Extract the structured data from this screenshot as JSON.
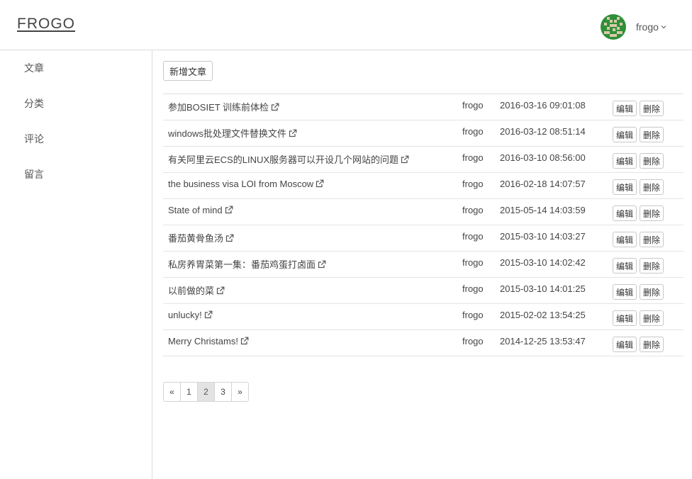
{
  "brand": "FROGO",
  "user": {
    "name": "frogo",
    "avatar_icon": "pixel-avatar-icon",
    "avatar_colors": {
      "primary": "#2f8f3a",
      "secondary": "#d9c9a8"
    }
  },
  "sidebar": {
    "items": [
      {
        "label": "文章"
      },
      {
        "label": "分类"
      },
      {
        "label": "评论"
      },
      {
        "label": "留言"
      }
    ]
  },
  "toolbar": {
    "new_article_label": "新增文章"
  },
  "articles": [
    {
      "title": "参加BOSIET 训练前体检",
      "author": "frogo",
      "date": "2016-03-16 09:01:08",
      "edit_label": "编辑",
      "delete_label": "删除"
    },
    {
      "title": "windows批处理文件替换文件",
      "author": "frogo",
      "date": "2016-03-12 08:51:14",
      "edit_label": "编辑",
      "delete_label": "删除"
    },
    {
      "title": "有关阿里云ECS的LINUX服务器可以开设几个网站的问题",
      "author": "frogo",
      "date": "2016-03-10 08:56:00",
      "edit_label": "编辑",
      "delete_label": "删除"
    },
    {
      "title": "the business visa LOI from Moscow",
      "author": "frogo",
      "date": "2016-02-18 14:07:57",
      "edit_label": "编辑",
      "delete_label": "删除"
    },
    {
      "title": "State of mind",
      "author": "frogo",
      "date": "2015-05-14 14:03:59",
      "edit_label": "编辑",
      "delete_label": "删除"
    },
    {
      "title": "番茄黄骨鱼汤",
      "author": "frogo",
      "date": "2015-03-10 14:03:27",
      "edit_label": "编辑",
      "delete_label": "删除"
    },
    {
      "title": "私房养胃菜第一集：番茄鸡蛋打卤面",
      "author": "frogo",
      "date": "2015-03-10 14:02:42",
      "edit_label": "编辑",
      "delete_label": "删除"
    },
    {
      "title": "以前做的菜",
      "author": "frogo",
      "date": "2015-03-10 14:01:25",
      "edit_label": "编辑",
      "delete_label": "删除"
    },
    {
      "title": "unlucky!",
      "author": "frogo",
      "date": "2015-02-02 13:54:25",
      "edit_label": "编辑",
      "delete_label": "删除"
    },
    {
      "title": "Merry Christams!",
      "author": "frogo",
      "date": "2014-12-25 13:53:47",
      "edit_label": "编辑",
      "delete_label": "删除"
    }
  ],
  "pagination": {
    "prev": "«",
    "pages": [
      "1",
      "2",
      "3"
    ],
    "current": "2",
    "next": "»"
  }
}
